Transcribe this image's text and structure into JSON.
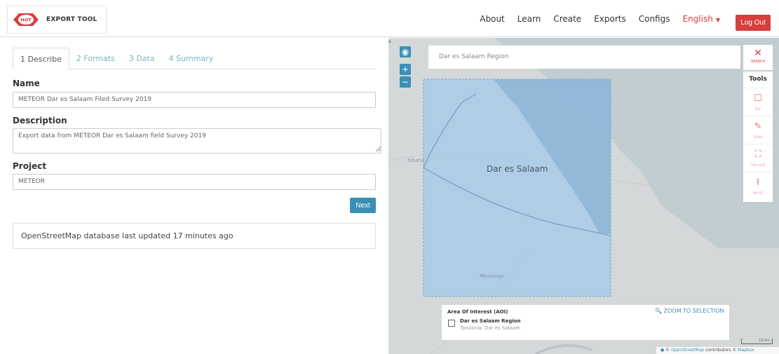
{
  "brand": {
    "logo_text": "HOT",
    "title": "EXPORT TOOL"
  },
  "nav": {
    "items": [
      "About",
      "Learn",
      "Create",
      "Exports",
      "Configs"
    ],
    "language": "English",
    "logout": "Log Out"
  },
  "tabs": [
    {
      "label": "1 Describe",
      "active": true
    },
    {
      "label": "2 Formats",
      "active": false
    },
    {
      "label": "3 Data",
      "active": false
    },
    {
      "label": "4 Summary",
      "active": false
    }
  ],
  "form": {
    "name_label": "Name",
    "name_value": "METEOR Dar es Salaam Filed Survey 2019",
    "description_label": "Description",
    "description_value": "Export data from METEOR Dar es Salaam field Survey 2019",
    "project_label": "Project",
    "project_value": "METEOR",
    "next_label": "Next"
  },
  "status": {
    "text": "OpenStreetMap database last updated 17 minutes ago"
  },
  "map": {
    "search_value": "Dar es Salaam Region",
    "search_close_label": "SEARCH",
    "tools_title": "Tools",
    "tools": [
      {
        "label": "BOX",
        "icon": "square-icon"
      },
      {
        "label": "DRAW",
        "icon": "pencil-icon"
      },
      {
        "label": "THIS VIEW",
        "icon": "fullscreen-icon"
      },
      {
        "label": "IMPORT",
        "icon": "upload-icon"
      }
    ],
    "city_label": "Dar es Salaam",
    "place_labels": [
      "Kibaha",
      "Mkuranga"
    ],
    "aoi": {
      "title": "Area Of Interest (AOI)",
      "zoom_label": "ZOOM TO SELECTION",
      "name": "Dar es Salaam Region",
      "subtitle": "Tanzania, Dar es Salaam"
    },
    "scale_label": "10 km",
    "attribution": {
      "prefix": "©",
      "osm": "OpenStreetMap",
      "middle": "contributors ©",
      "mapbox": "Mapbox"
    },
    "colors": {
      "land": "#d4d8d9",
      "water": "#c2cdd1",
      "aoi_fill": "#a8cbe8",
      "aoi_stroke": "#6fa3c8",
      "accent": "#3b8fb4",
      "danger": "#d73f3f"
    }
  }
}
